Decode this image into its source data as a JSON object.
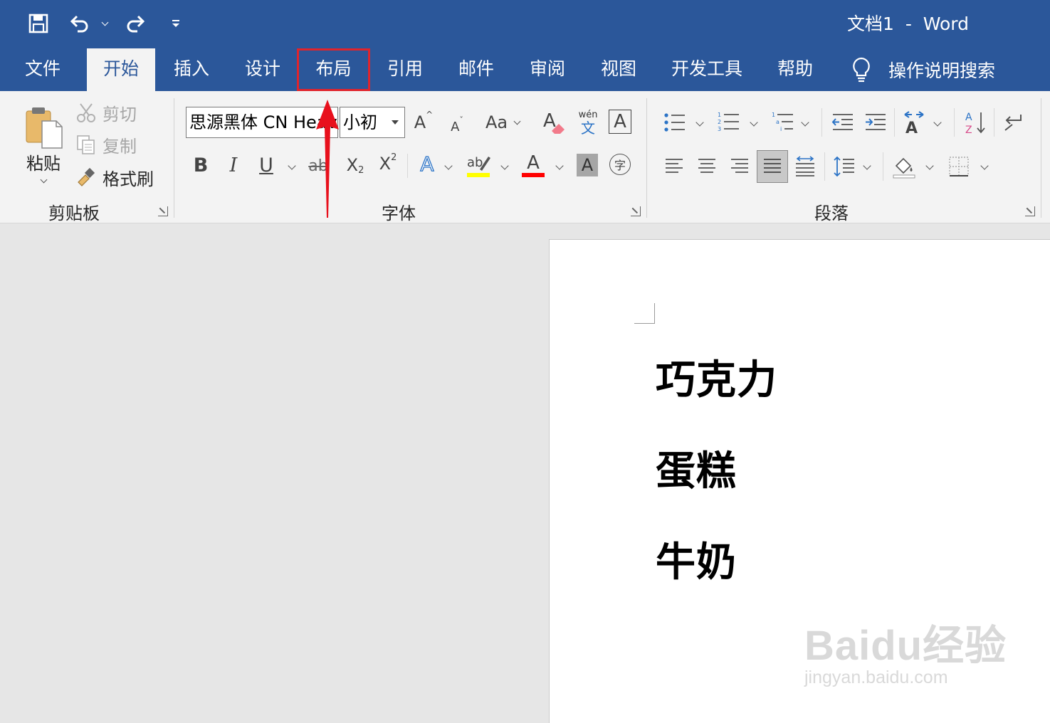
{
  "window": {
    "title": "文档1  -  Word"
  },
  "quick_access": {
    "save_icon": "save-icon",
    "undo_icon": "undo-icon",
    "redo_icon": "redo-icon",
    "customize_icon": "customize-qat-icon"
  },
  "tabs": [
    {
      "label": "文件"
    },
    {
      "label": "开始"
    },
    {
      "label": "插入"
    },
    {
      "label": "设计"
    },
    {
      "label": "布局"
    },
    {
      "label": "引用"
    },
    {
      "label": "邮件"
    },
    {
      "label": "审阅"
    },
    {
      "label": "视图"
    },
    {
      "label": "开发工具"
    },
    {
      "label": "帮助"
    }
  ],
  "active_tab": "开始",
  "highlighted_tab": "布局",
  "tell_me": {
    "label": "操作说明搜索"
  },
  "clipboard": {
    "group_label": "剪贴板",
    "paste": "粘贴",
    "cut": "剪切",
    "copy": "复制",
    "format_painter": "格式刷"
  },
  "font": {
    "group_label": "字体",
    "font_name": "思源黑体 CN Heavy",
    "font_size": "小初",
    "case_label": "Aa",
    "bold": "B",
    "italic": "I",
    "underline": "U",
    "strike": "ab",
    "sub": "X",
    "sup": "X",
    "highlight_text": "ab",
    "color_letter": "A",
    "shade_letter": "A",
    "enclose": "字",
    "phonetic_top": "wén",
    "phonetic_bottom": "文",
    "grow": "A",
    "shrink": "A",
    "effects": "A"
  },
  "paragraph": {
    "group_label": "段落"
  },
  "document": {
    "paragraphs": [
      "巧克力",
      "蛋糕",
      "牛奶"
    ]
  },
  "watermark": {
    "main": "Baidu经验",
    "sub": "jingyan.baidu.com"
  },
  "colors": {
    "word_blue": "#2b579a",
    "highlight_red": "#e0242c",
    "highlight_yellow": "#ffff00",
    "font_red": "#ff0000"
  }
}
